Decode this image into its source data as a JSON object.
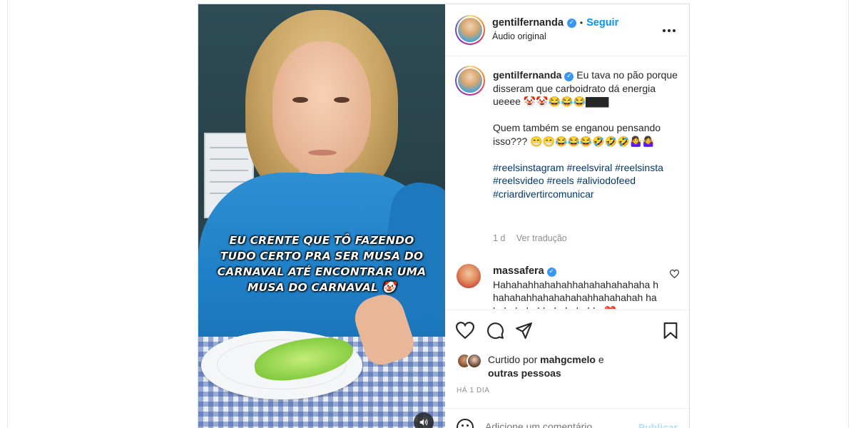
{
  "post": {
    "author": {
      "username": "gentilfernanda",
      "verified": true,
      "follow_label": "Seguir",
      "audio_label": "Áudio original",
      "more_icon": "more-horizontal-icon"
    },
    "video": {
      "overlay_text": "EU CRENTE QUE TÔ FAZENDO TUDO CERTO PRA SER MUSA DO CARNAVAL ATÉ ENCONTRAR UMA MUSA DO CARNAVAL 🤡",
      "mute_icon": "volume-icon"
    },
    "caption": {
      "username": "gentilfernanda",
      "line1": "Eu tava no pão porque disseram que carboidrato dá energia ueeee 🤡🤡😂😂😂▇▇▇",
      "line2": "Quem também se enganou pensando isso??? 😁😁😂😂😂🤣🤣🤣🤷‍♀️🤷‍♀️",
      "hashtags": "#reelsinstagram #reelsviral #reelsinsta #reelsvideo #reels #aliviodofeed #criardivertircomunicar",
      "time": "1 d",
      "translate_label": "Ver tradução"
    },
    "comments": [
      {
        "username": "massafera",
        "verified": true,
        "text": "Hahahahhahahahhahahahahahaha hhahahahhahahahahahhahahahah hahahahahahhahahahahha❤️"
      }
    ],
    "actions": {
      "like_icon": "heart-icon",
      "comment_icon": "comment-icon",
      "share_icon": "share-icon",
      "save_icon": "bookmark-icon"
    },
    "likes": {
      "prefix": "Curtido por",
      "user": "mahgcmelo",
      "connector": "e",
      "suffix": "outras pessoas"
    },
    "timestamp": "HÁ 1 DIA",
    "add_comment": {
      "placeholder": "Adicione um comentário...",
      "publish_label": "Publicar"
    }
  },
  "colors": {
    "accent": "#0095f6",
    "hashtag": "#00376b",
    "publish_disabled": "#b2dffc",
    "verified": "#3897f0"
  }
}
